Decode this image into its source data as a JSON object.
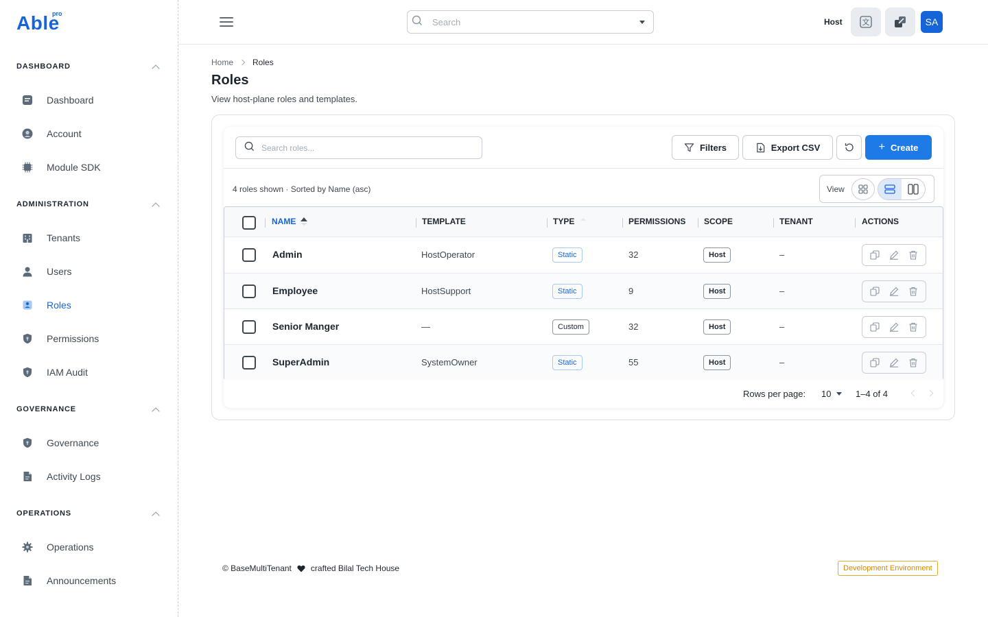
{
  "brand": {
    "name": "Able",
    "sup": "pro"
  },
  "sidebar": {
    "sections": [
      {
        "label": "DASHBOARD",
        "items": [
          {
            "label": "Dashboard",
            "icon": "dashboard-icon"
          },
          {
            "label": "Account",
            "icon": "account-icon"
          },
          {
            "label": "Module SDK",
            "icon": "chip-icon"
          }
        ]
      },
      {
        "label": "ADMINISTRATION",
        "items": [
          {
            "label": "Tenants",
            "icon": "building-icon"
          },
          {
            "label": "Users",
            "icon": "user-icon"
          },
          {
            "label": "Roles",
            "icon": "roles-icon",
            "active": true
          },
          {
            "label": "Permissions",
            "icon": "shield-icon"
          },
          {
            "label": "IAM Audit",
            "icon": "shield-icon"
          }
        ]
      },
      {
        "label": "GOVERNANCE",
        "items": [
          {
            "label": "Governance",
            "icon": "shield-icon"
          },
          {
            "label": "Activity Logs",
            "icon": "document-icon"
          }
        ]
      },
      {
        "label": "OPERATIONS",
        "items": [
          {
            "label": "Operations",
            "icon": "gear-icon"
          },
          {
            "label": "Announcements",
            "icon": "document-icon"
          }
        ]
      }
    ]
  },
  "header": {
    "search_placeholder": "Search",
    "host_label": "Host",
    "avatar_initials": "SA"
  },
  "breadcrumb": {
    "home": "Home",
    "current": "Roles"
  },
  "page": {
    "title": "Roles",
    "subtitle": "View host-plane roles and templates."
  },
  "toolbar": {
    "search_placeholder": "Search roles...",
    "filters_label": "Filters",
    "export_label": "Export CSV",
    "create_label": "Create"
  },
  "summary": "4 roles shown · Sorted by Name (asc)",
  "view": {
    "label": "View"
  },
  "table": {
    "columns": [
      "NAME",
      "TEMPLATE",
      "TYPE",
      "PERMISSIONS",
      "SCOPE",
      "TENANT",
      "ACTIONS"
    ],
    "rows": [
      {
        "name": "Admin",
        "template": "HostOperator",
        "type": "Static",
        "permissions": "32",
        "scope": "Host",
        "tenant": "–"
      },
      {
        "name": "Employee",
        "template": "HostSupport",
        "type": "Static",
        "permissions": "9",
        "scope": "Host",
        "tenant": "–"
      },
      {
        "name": "Senior Manger",
        "template": "—",
        "type": "Custom",
        "permissions": "32",
        "scope": "Host",
        "tenant": "–"
      },
      {
        "name": "SuperAdmin",
        "template": "SystemOwner",
        "type": "Static",
        "permissions": "55",
        "scope": "Host",
        "tenant": "–"
      }
    ]
  },
  "pagination": {
    "rows_per_page_label": "Rows per page:",
    "rows_per_page": "10",
    "range": "1–4 of 4"
  },
  "footer": {
    "copyright": "© BaseMultiTenant",
    "crafted": "crafted Bilal Tech House",
    "environment": "Development Environment"
  },
  "colors": {
    "accent": "#1565d8",
    "create_button": "#1e7ae6",
    "env_badge": "#d48806"
  }
}
